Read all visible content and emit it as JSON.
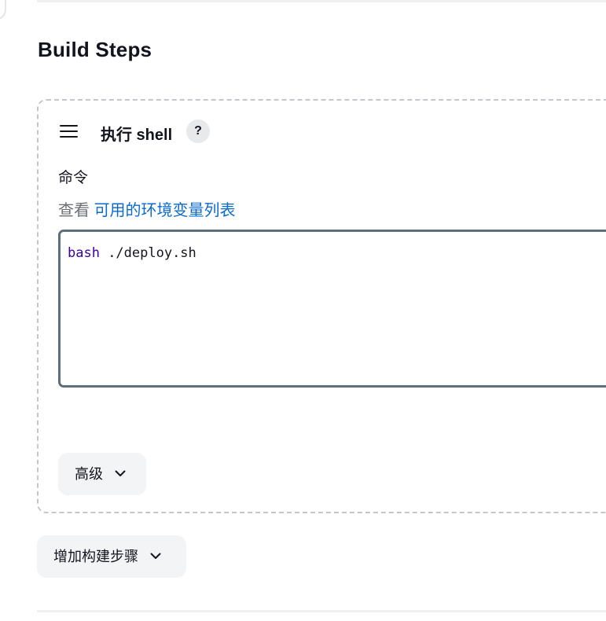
{
  "section": {
    "title": "Build Steps"
  },
  "step": {
    "title": "执行 shell",
    "help_icon_text": "?",
    "command_label": "命令",
    "desc_prefix": "查看 ",
    "env_link_text": "可用的环境变量列表",
    "code": {
      "keyword": "bash",
      "rest": " ./deploy.sh"
    },
    "advanced_label": "高级"
  },
  "add_step_label": "增加构建步骤",
  "icons": {
    "drag": "hamburger-drag-icon",
    "help": "question-mark-icon",
    "chevron": "chevron-down-icon"
  },
  "colors": {
    "link": "#0b6bcb",
    "keyword": "#3b00a8",
    "editor_border": "#5c707c",
    "button_bg": "#f3f4f6"
  }
}
